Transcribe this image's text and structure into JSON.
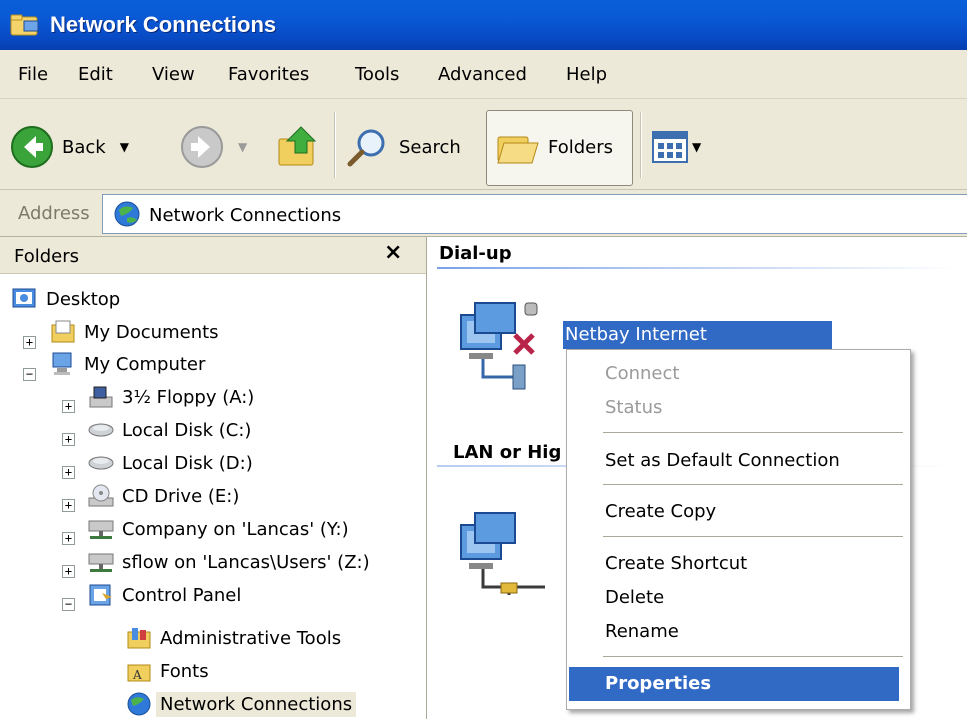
{
  "window": {
    "title": "Network Connections"
  },
  "menu": [
    "File",
    "Edit",
    "View",
    "Favorites",
    "Tools",
    "Advanced",
    "Help"
  ],
  "toolbar": {
    "back": "Back",
    "search": "Search",
    "folders": "Folders"
  },
  "address": {
    "label": "Address",
    "value": "Network Connections"
  },
  "folders_pane": {
    "header": "Folders",
    "close": "×",
    "tree": [
      "Desktop",
      "My Documents",
      "My Computer",
      "3½ Floppy (A:)",
      "Local Disk (C:)",
      "Local Disk (D:)",
      "CD Drive (E:)",
      "Company on 'Lancas' (Y:)",
      "sflow on 'Lancas\\Users' (Z:)",
      "Control Panel",
      "Administrative Tools",
      "Fonts",
      "Network Connections"
    ],
    "expanders": {
      "plus": "+",
      "minus": "−"
    }
  },
  "content": {
    "group_dialup": "Dial-up",
    "group_lan": "LAN or Hig",
    "selected_connection": "Netbay Internet"
  },
  "context_menu": {
    "items": [
      "Connect",
      "Status",
      "Set as Default Connection",
      "Create Copy",
      "Create Shortcut",
      "Delete",
      "Rename",
      "Properties"
    ],
    "disabled": [
      "Connect",
      "Status"
    ],
    "highlighted": "Properties"
  },
  "colors": {
    "titlebar": "#0a5fd8",
    "selection": "#316ac5",
    "chrome": "#ece9d8"
  }
}
